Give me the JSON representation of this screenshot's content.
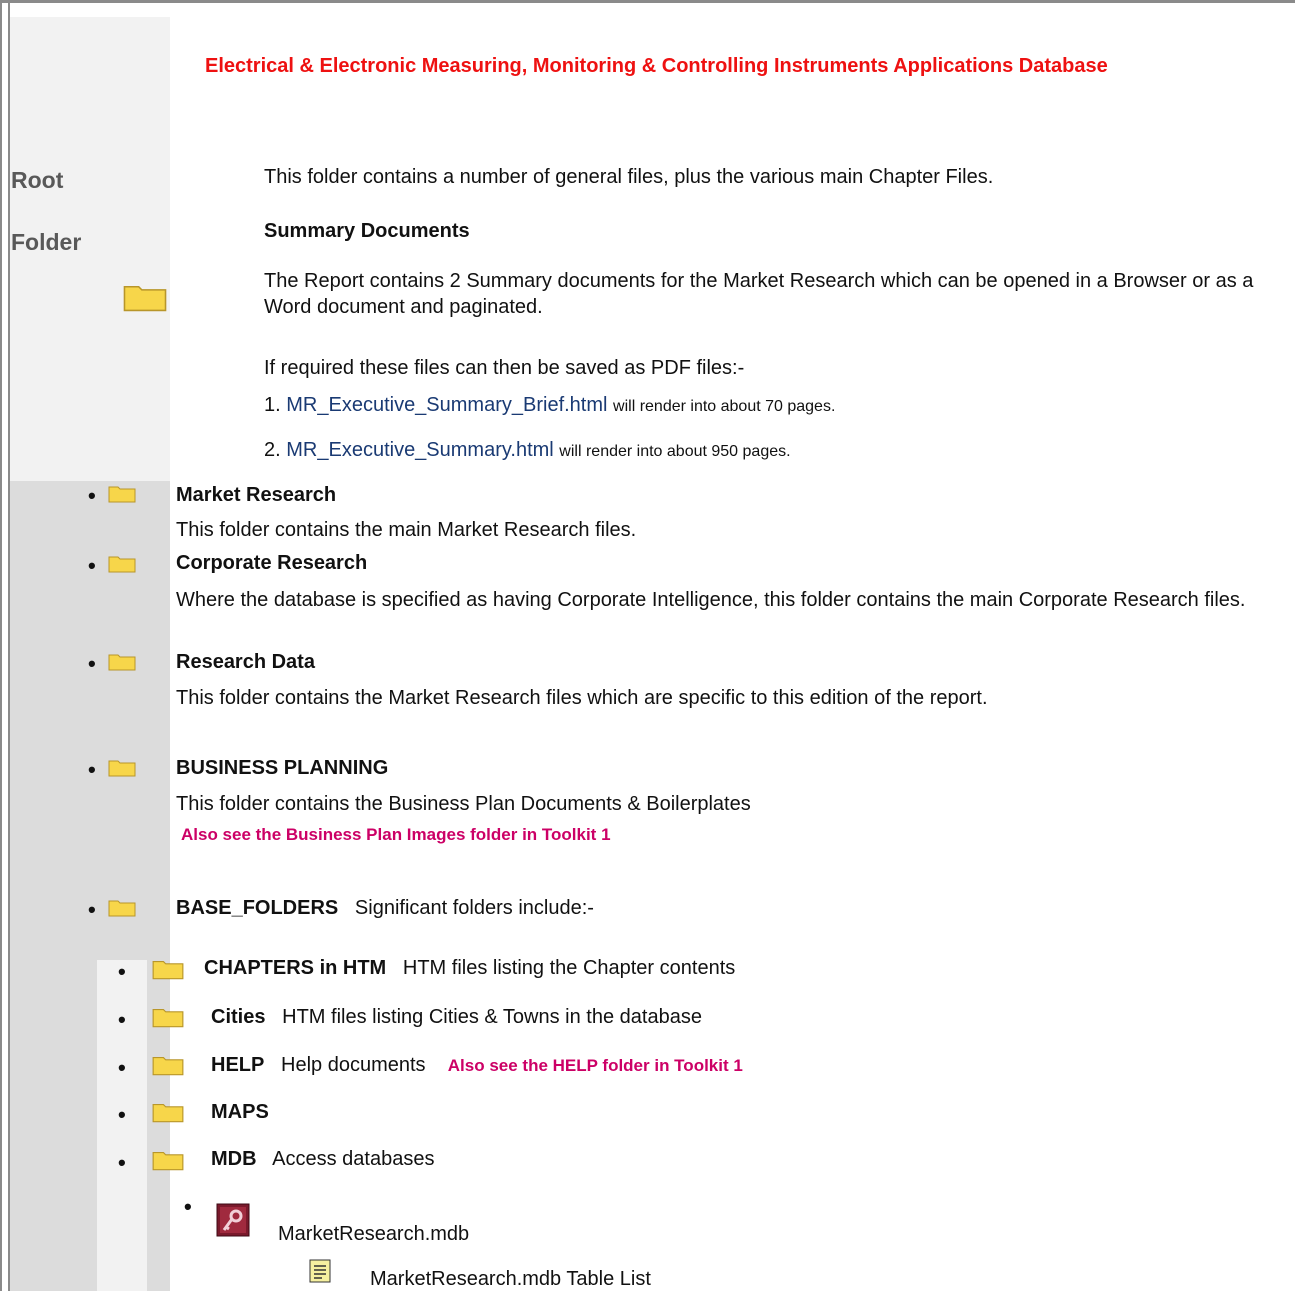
{
  "title": "Electrical & Electronic Measuring, Monitoring & Controlling Instruments Applications Database",
  "root_label": {
    "line1": "Root",
    "line2": "Folder"
  },
  "intro": "This folder contains a number of general files, plus the various main Chapter Files.",
  "summary": {
    "heading": "Summary Documents",
    "text": "The Report contains 2 Summary documents for the Market Research which can be opened in a Browser or as a Word document and paginated.",
    "pdf_note": "If required these files can then be saved as PDF files:-",
    "items": [
      {
        "num": "1.",
        "link": "MR_Executive_Summary_Brief.html",
        "rest": "will render into about 70 pages."
      },
      {
        "num": "2.",
        "link": "MR_Executive_Summary.html",
        "rest": "will render into about 950 pages."
      }
    ]
  },
  "folders": [
    {
      "name": "Market Research",
      "desc": "This folder contains the main Market Research files."
    },
    {
      "name": "Corporate Research",
      "desc": "Where the database is specified as having Corporate Intelligence, this folder contains the main Corporate Research files."
    },
    {
      "name": "Research Data",
      "desc": "This folder contains the Market Research files which are specific to this edition of the report."
    },
    {
      "name": "BUSINESS PLANNING",
      "desc": "This folder contains the Business Plan Documents & Boilerplates",
      "note": "Also see the Business Plan Images folder in Toolkit 1"
    },
    {
      "name": "BASE_FOLDERS",
      "desc": "Significant folders include:-"
    }
  ],
  "subfolders": [
    {
      "name": "CHAPTERS in HTM",
      "desc": "HTM files listing the Chapter contents"
    },
    {
      "name": "Cities",
      "desc": "HTM files listing Cities & Towns in the database"
    },
    {
      "name": "HELP",
      "desc": "Help documents",
      "note": "Also see the HELP folder in Toolkit 1"
    },
    {
      "name": "MAPS",
      "desc": ""
    },
    {
      "name": "MDB",
      "desc": "Access databases"
    }
  ],
  "mdb_files": {
    "db": "MarketResearch.mdb",
    "table_list": "MarketResearch.mdb Table List"
  },
  "icons": {
    "folder": "folder-icon",
    "access": "access-db-icon",
    "document": "text-document-icon"
  },
  "colors": {
    "title": "#ee1111",
    "note": "#cc0066",
    "link": "#1a3a73",
    "folder": "#f7d64a"
  }
}
